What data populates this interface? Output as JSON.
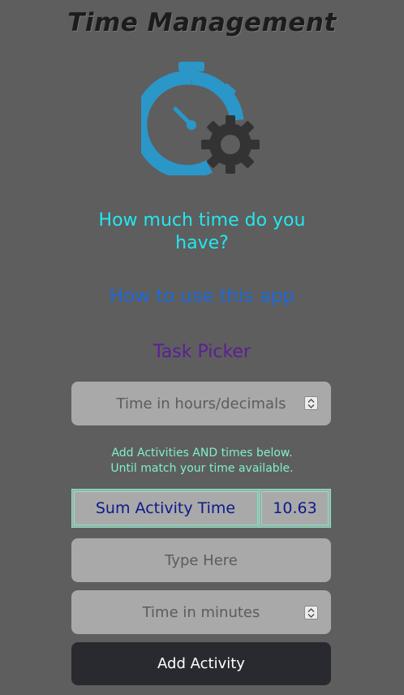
{
  "header": {
    "title": "Time Management",
    "logo_icon": "stopwatch-gear-icon"
  },
  "intro": {
    "question": "How much time do you have?",
    "how_to_link": "How to use this app",
    "task_picker_link": "Task Picker"
  },
  "form": {
    "hours_placeholder": "Time in hours/decimals",
    "hint_line1": "Add Activities AND times below.",
    "hint_line2": "Until match your time available.",
    "sum_label": "Sum Activity Time",
    "sum_value": "10.63",
    "activity_placeholder": "Type Here",
    "minutes_placeholder": "Time in minutes",
    "add_button": "Add Activity"
  },
  "colors": {
    "background": "#5e5e5e",
    "question": "#22e8ee",
    "link": "#1e6ad8",
    "task_picker": "#5a1f96",
    "hint": "#7ff0c8",
    "sum_text": "#0d1a8a",
    "button": "#292a30",
    "logo_blue": "#2a97c8",
    "logo_gear": "#333333"
  }
}
